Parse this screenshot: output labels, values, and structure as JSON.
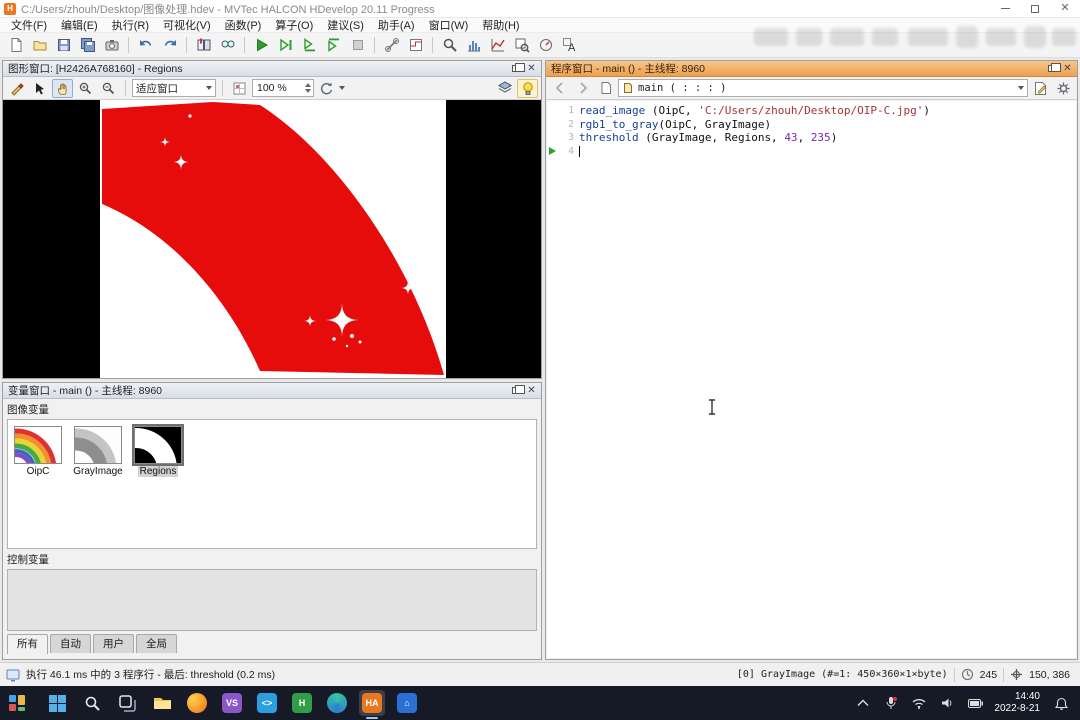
{
  "titlebar": {
    "title": "C:/Users/zhouh/Desktop/图像处理.hdev - MVTec HALCON HDevelop 20.11 Progress"
  },
  "menubar": {
    "items": [
      "文件(F)",
      "编辑(E)",
      "执行(R)",
      "可视化(V)",
      "函数(P)",
      "算子(O)",
      "建议(S)",
      "助手(A)",
      "窗口(W)",
      "帮助(H)"
    ]
  },
  "graphics_window": {
    "title": "图形窗口: [H2426A768160] - Regions",
    "fit_mode": "适应窗口",
    "zoom_value": "100 %"
  },
  "variable_window": {
    "title": "变量窗口 - main () - 主线程: 8960",
    "image_section_label": "图像变量",
    "control_section_label": "控制变量",
    "image_variables": [
      {
        "name": "OipC"
      },
      {
        "name": "GrayImage"
      },
      {
        "name": "Regions"
      }
    ],
    "tabs": [
      {
        "label": "所有",
        "active": true
      },
      {
        "label": "自动",
        "active": false
      },
      {
        "label": "用户",
        "active": false
      },
      {
        "label": "全局",
        "active": false
      }
    ]
  },
  "program_window": {
    "title": "程序窗口 - main () - 主线程: 8960",
    "procedure": "main ( : : : )",
    "code_lines": [
      {
        "num": "1",
        "current": false,
        "segments": [
          {
            "c": "op",
            "t": "read_image"
          },
          {
            "c": "pl",
            "t": " (OipC, "
          },
          {
            "c": "str",
            "t": "'C:/Users/zhouh/Desktop/OIP-C.jpg'"
          },
          {
            "c": "pl",
            "t": ")"
          }
        ]
      },
      {
        "num": "2",
        "current": false,
        "segments": [
          {
            "c": "op",
            "t": "rgb1_to_gray"
          },
          {
            "c": "pl",
            "t": "(OipC, GrayImage)"
          }
        ]
      },
      {
        "num": "3",
        "current": false,
        "segments": [
          {
            "c": "op",
            "t": "threshold"
          },
          {
            "c": "pl",
            "t": " (GrayImage, Regions, "
          },
          {
            "c": "num",
            "t": "43"
          },
          {
            "c": "pl",
            "t": ", "
          },
          {
            "c": "num",
            "t": "235"
          },
          {
            "c": "pl",
            "t": ")"
          }
        ]
      },
      {
        "num": "4",
        "current": true,
        "segments": []
      }
    ]
  },
  "statusbar": {
    "run_info": "执行 46.1 ms 中的 3 程序行 - 最后: threshold (0.2 ms)",
    "image_info": "[0] GrayImage (#=1: 450×360×1×byte)",
    "gray_value": "245",
    "cursor_pos": "150, 386"
  },
  "taskbar": {
    "time": "14:40",
    "date": "2022-8-21"
  }
}
